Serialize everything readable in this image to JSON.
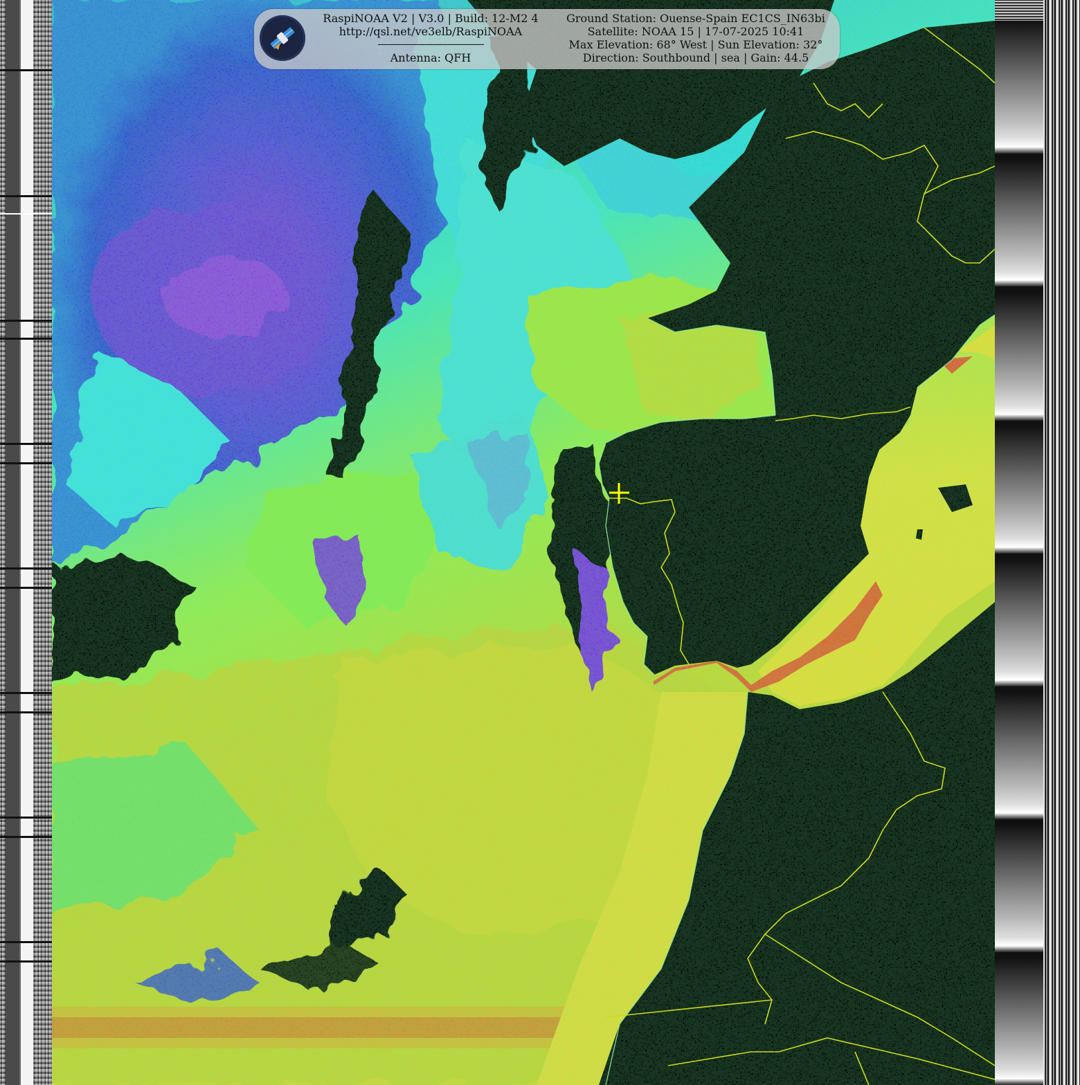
{
  "header": {
    "left": {
      "line1": "RaspiNOAA V2 | V3.0 | Build: 12-M2 4",
      "line2": "http://qsl.net/ve3elb/RaspiNOAA",
      "separator": "-----------------------------------------",
      "line4": "Antenna: QFH"
    },
    "right": {
      "line1": "Ground Station: Ouense-Spain EC1CS_IN63bi",
      "line2": "Satellite: NOAA 15 | 17-07-2025 10:41",
      "line3": "Max Elevation: 68° West | Sun Elevation: 32°",
      "line4": "Direction: Southbound | sea | Gain: 44.5"
    }
  },
  "logo": {
    "icon": "satellite-icon"
  },
  "map": {
    "ground_station_marker": "crosshair-icon",
    "palette": {
      "land": "#000000",
      "border": "#e6d400",
      "coast": "#9ee89a",
      "cold_cloud_purple": "#7a2fe0",
      "cloud_blue": "#2f3fd8",
      "cyan": "#2fd8e8",
      "green": "#7fe84a",
      "yellow_green": "#c8d82f",
      "warm_yellow": "#f0d830",
      "hot_red": "#e8502a",
      "marker": "#ffff00"
    }
  },
  "telemetry": {
    "left_strip": "telemetry-strip",
    "right_strip": "calibration-wedges"
  }
}
